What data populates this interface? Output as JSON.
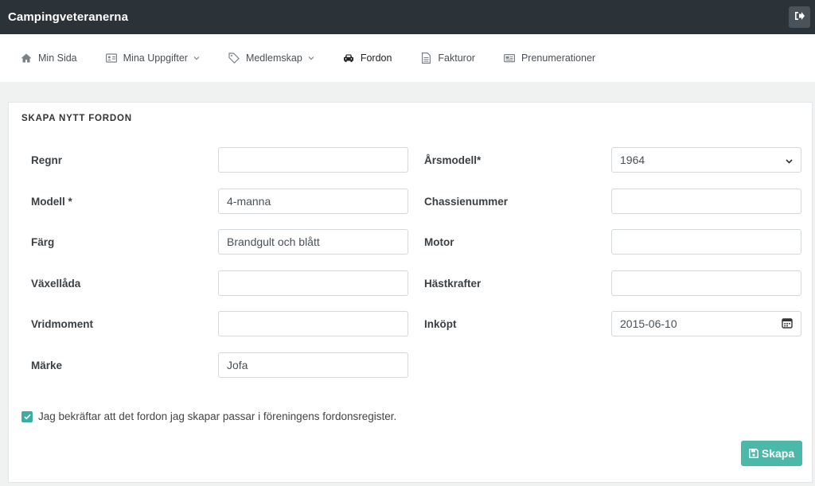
{
  "header": {
    "brand": "Campingveteranerna",
    "logout_icon": "sign-out-icon"
  },
  "nav": [
    {
      "label": "Min Sida",
      "icon": "home-icon",
      "dropdown": false
    },
    {
      "label": "Mina Uppgifter",
      "icon": "id-card-icon",
      "dropdown": true
    },
    {
      "label": "Medlemskap",
      "icon": "tag-icon",
      "dropdown": true
    },
    {
      "label": "Fordon",
      "icon": "car-icon",
      "dropdown": false
    },
    {
      "label": "Fakturor",
      "icon": "document-icon",
      "dropdown": false
    },
    {
      "label": "Prenumerationer",
      "icon": "newspaper-icon",
      "dropdown": false
    }
  ],
  "form": {
    "title": "SKAPA NYTT FORDON",
    "regnr": {
      "label": "Regnr",
      "value": ""
    },
    "modell": {
      "label": "Modell *",
      "value": "4-manna"
    },
    "farg": {
      "label": "Färg",
      "value": "Brandgult och blått"
    },
    "vaxellada": {
      "label": "Växellåda",
      "value": ""
    },
    "vridmoment": {
      "label": "Vridmoment",
      "value": ""
    },
    "marke": {
      "label": "Märke",
      "value": "Jofa"
    },
    "arsmodell": {
      "label": "Årsmodell*",
      "value": "1964"
    },
    "chassienummer": {
      "label": "Chassienummer",
      "value": ""
    },
    "motor": {
      "label": "Motor",
      "value": ""
    },
    "hastkrafter": {
      "label": "Hästkrafter",
      "value": ""
    },
    "inkopt": {
      "label": "Inköpt",
      "value": "2015-06-10"
    },
    "confirm": {
      "label": "Jag bekräftar att det fordon jag skapar passar i föreningens fordonsregister.",
      "checked": true
    },
    "submit": {
      "label": "Skapa"
    }
  },
  "colors": {
    "topbar": "#2c3338",
    "accent": "#4bb8a9",
    "checkbox": "#3aaea2"
  }
}
